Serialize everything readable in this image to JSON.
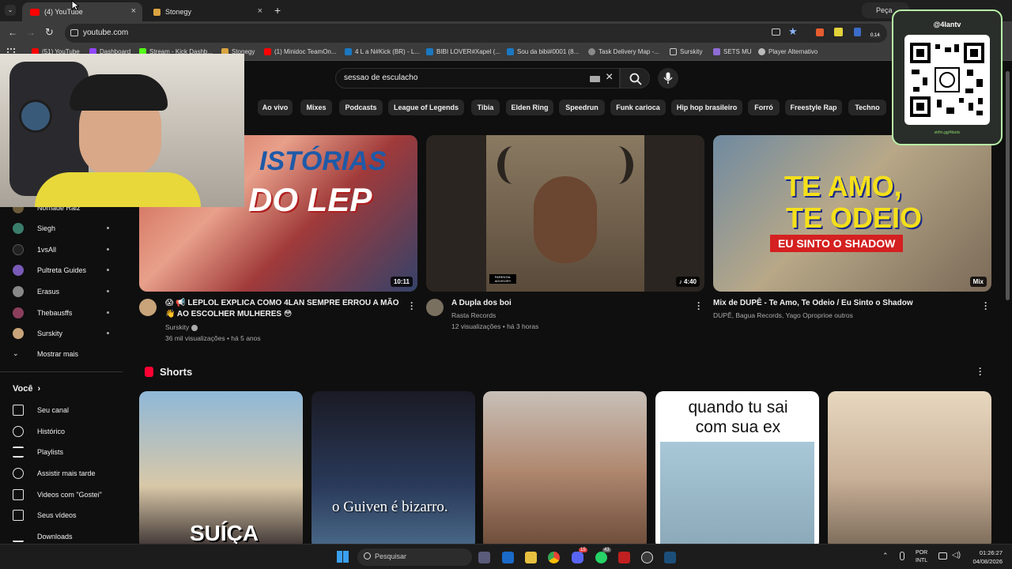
{
  "browser": {
    "tabs": [
      {
        "label": "(4) YouTube",
        "active": true
      },
      {
        "label": "Stonegy",
        "active": false
      }
    ],
    "new_tab": "+",
    "close": "×",
    "right_tab_label": "Peça",
    "url": "youtube.com",
    "bookmarks": [
      "(51) YouTube",
      "Dashboard",
      "Stream - Kick Dashb...",
      "Stonegy",
      "(1) Minidoc TeamOn...",
      "4 L a N#Kick (BR) - L...",
      "BIBI LOVER#Xapel (...",
      "Sou da bibi#0001 (8...",
      "Task Delivery Map -...",
      "Surskity",
      "SETS MU",
      "Player Alternativo"
    ],
    "ext_badge": "0.14"
  },
  "overlay": {
    "handle": "@4lantv",
    "link": "strfm.gg/4lantv"
  },
  "youtube": {
    "search_query": "sessao de esculacho",
    "chips": [
      "Ao vivo",
      "Mixes",
      "Podcasts",
      "League of Legends",
      "Tibia",
      "Elden Ring",
      "Speedrun",
      "Funk carioca",
      "Hip hop brasileiro",
      "Forró",
      "Freestyle Rap",
      "Techno"
    ],
    "sidebar": {
      "subscriptions": [
        {
          "name": "Nomade Raiz",
          "color": "#6b5b3a"
        },
        {
          "name": "Siegh",
          "color": "#3a7d6b"
        },
        {
          "name": "1vsAll",
          "color": "#222222"
        },
        {
          "name": "Pultreta Guides",
          "color": "#7a5ab8"
        },
        {
          "name": "Erasus",
          "color": "#888888"
        },
        {
          "name": "Thebausffs",
          "color": "#8a3f5c"
        },
        {
          "name": "Surskity",
          "color": "#c9a47a"
        }
      ],
      "show_more": "Mostrar mais",
      "you_section": "Você",
      "you_items": [
        "Seu canal",
        "Histórico",
        "Playlists",
        "Assistir mais tarde",
        "Videos com \"Gostei\"",
        "Seus vídeos",
        "Downloads"
      ]
    },
    "videos": [
      {
        "thumb_text_1": "ISTÓRIAS",
        "thumb_text_2": "DO LEP",
        "duration": "10:11",
        "title_line1": "😱 📢 LEPLOL EXPLICA COMO 4LAN SEMPRE ERROU A MÃO",
        "title_line2": "👋 AO ESCOLHER MULHERES 😳",
        "channel": "Surskity",
        "meta": "36 mil visualizações • há 5 anos"
      },
      {
        "duration": "♪ 4:40",
        "cover_label": "PARENTAL ADVISORY",
        "title": "A Dupla dos boi",
        "channel": "Rasta Records",
        "meta": "12 visualizações • há 3 horas"
      },
      {
        "thumb_text_1": "TE AMO,",
        "thumb_text_2": "TE ODEIO",
        "thumb_text_3": "EU SINTO O SHADOW",
        "duration": "Mix",
        "title": "Mix de DUPÊ - Te Amo, Te Odeio / Eu Sinto o Shadow",
        "channel": "DUPÊ, Bagua Records, Yago Oproprioe outros"
      }
    ],
    "shorts_label": "Shorts",
    "shorts": [
      {
        "caption": "SUÍÇA"
      },
      {
        "caption": "o Guiven é bizarro."
      },
      {
        "caption": ""
      },
      {
        "caption": "quando tu sai com sua ex"
      },
      {
        "caption": ""
      }
    ]
  },
  "taskbar": {
    "search": "Pesquisar",
    "lang_1": "POR",
    "lang_2": "INTL",
    "time": "01:26:27",
    "date": "04/08/2026",
    "badge_discord": "15",
    "badge_whatsapp": "43"
  }
}
